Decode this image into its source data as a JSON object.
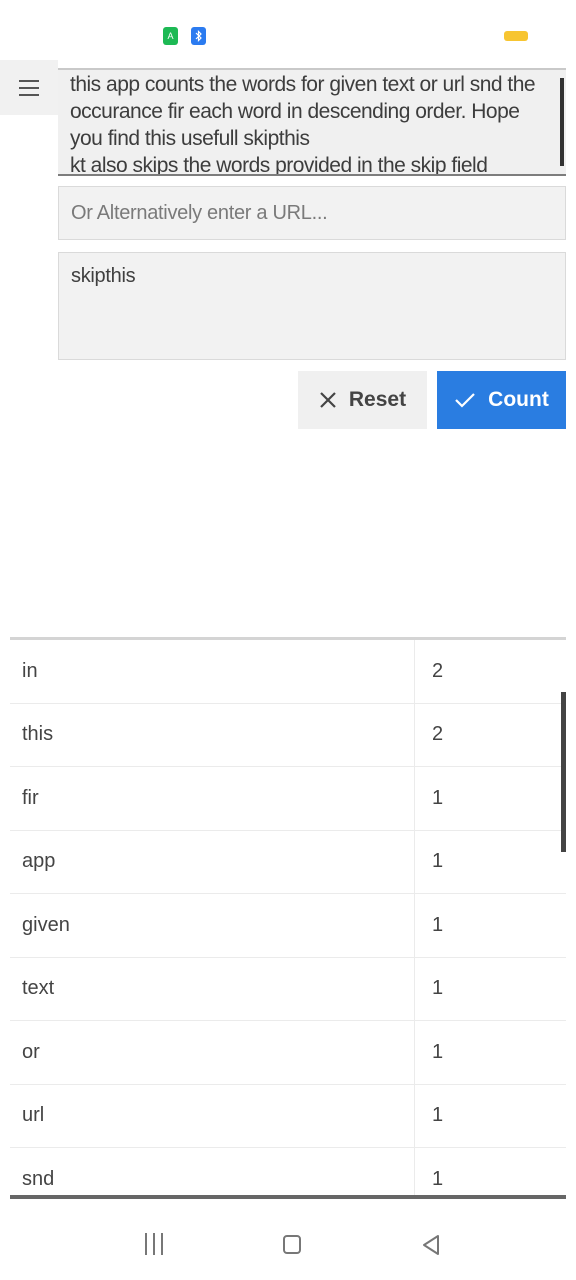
{
  "status_bar": {
    "app_icon_label": "A",
    "bluetooth_icon": "bluetooth-icon",
    "battery_color": "#f7c531"
  },
  "input": {
    "text_value": "this app counts the words for given text or url snd the occurance fir each word in descending order. Hope you find this usefull skipthis\nkt also skips the words provided in the skip field",
    "url_placeholder": "Or Alternatively enter a URL...",
    "skip_value": "skipthis"
  },
  "buttons": {
    "reset_label": "Reset",
    "count_label": "Count",
    "reset_icon": "close-icon",
    "count_icon": "check-icon"
  },
  "results": {
    "rows": [
      {
        "word": "in",
        "count": "2"
      },
      {
        "word": "this",
        "count": "2"
      },
      {
        "word": "fir",
        "count": "1"
      },
      {
        "word": "app",
        "count": "1"
      },
      {
        "word": "given",
        "count": "1"
      },
      {
        "word": "text",
        "count": "1"
      },
      {
        "word": "or",
        "count": "1"
      },
      {
        "word": "url",
        "count": "1"
      },
      {
        "word": "snd",
        "count": "1"
      }
    ]
  },
  "colors": {
    "accent": "#2a7de1",
    "field_bg": "#f2f2f2"
  }
}
